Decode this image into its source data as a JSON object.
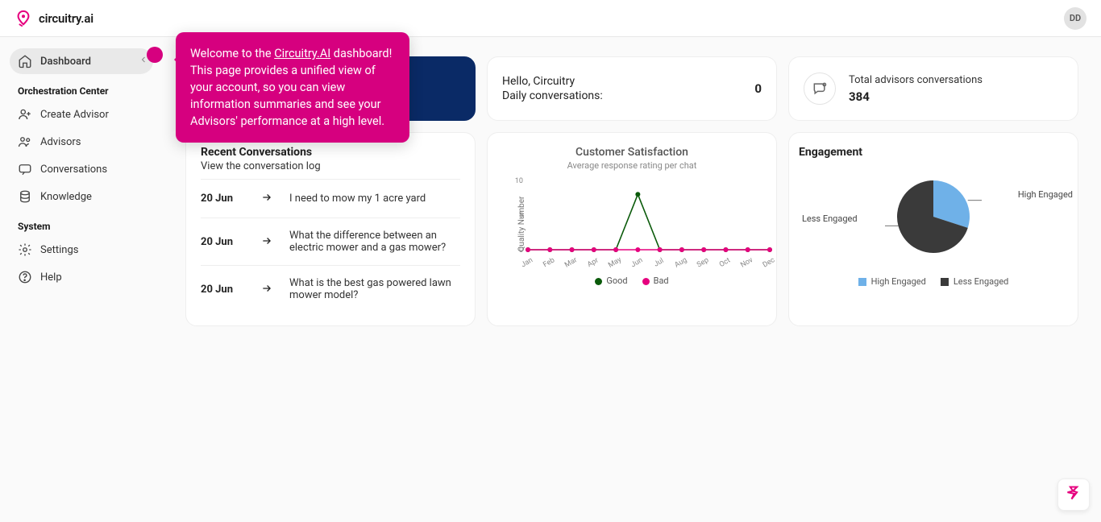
{
  "brand": {
    "name": "circuitry.ai"
  },
  "user": {
    "initials": "DD"
  },
  "sidebar": {
    "items": [
      {
        "label": "Dashboard",
        "icon": "home",
        "active": true
      },
      {
        "label": "Create Advisor",
        "icon": "user-plus"
      },
      {
        "label": "Advisors",
        "icon": "users"
      },
      {
        "label": "Conversations",
        "icon": "message"
      },
      {
        "label": "Knowledge",
        "icon": "db"
      },
      {
        "label": "Settings",
        "icon": "gear"
      },
      {
        "label": "Help",
        "icon": "help"
      }
    ],
    "sections": {
      "orchestration": "Orchestration Center",
      "system": "System"
    }
  },
  "tour": {
    "prefix": "Welcome to the ",
    "link": "Circuitry.AI",
    "rest": " dashboard! This page provides a unified view of your account, so you can view information summaries and see your Advisors' performance at a high level."
  },
  "hello": {
    "greeting": "Hello, Circuitry",
    "daily_label": "Daily conversations:",
    "daily_value": "0"
  },
  "stat": {
    "label": "Total advisors conversations",
    "value": "384"
  },
  "recent": {
    "title": "Recent Conversations",
    "subtitle": "View the conversation log",
    "rows": [
      {
        "date": "20 Jun",
        "text": "I need to mow my 1 acre yard"
      },
      {
        "date": "20 Jun",
        "text": "What the difference between an electric mower and a gas mower?"
      },
      {
        "date": "20 Jun",
        "text": "What is the best gas powered lawn mower model?"
      }
    ]
  },
  "satisfaction": {
    "title": "Customer Satisfaction",
    "subtitle": "Average response rating per chat",
    "ylabel": "Quality Number",
    "legend": {
      "good": "Good",
      "bad": "Bad"
    }
  },
  "engagement": {
    "title": "Engagement",
    "labels": {
      "high": "High Engaged",
      "less": "Less Engaged"
    }
  },
  "chart_data": [
    {
      "type": "line",
      "title": "Customer Satisfaction",
      "subtitle": "Average response rating per chat",
      "xlabel": "",
      "ylabel": "Quality Number",
      "ylim": [
        0,
        10
      ],
      "categories": [
        "Jan",
        "Feb",
        "Mar",
        "Apr",
        "May",
        "Jun",
        "Jul",
        "Aug",
        "Sep",
        "Oct",
        "Nov",
        "Dec"
      ],
      "series": [
        {
          "name": "Good",
          "color": "#0a5a0a",
          "values": [
            0,
            0,
            0,
            0,
            0,
            8,
            0,
            0,
            0,
            0,
            0,
            0
          ]
        },
        {
          "name": "Bad",
          "color": "#e6007e",
          "values": [
            0,
            0,
            0,
            0,
            0,
            0,
            0,
            0,
            0,
            0,
            0,
            0
          ]
        }
      ]
    },
    {
      "type": "pie",
      "title": "Engagement",
      "series": [
        {
          "name": "High Engaged",
          "color": "#6fb1e8",
          "value": 30
        },
        {
          "name": "Less Engaged",
          "color": "#3a3a3a",
          "value": 70
        }
      ]
    }
  ]
}
